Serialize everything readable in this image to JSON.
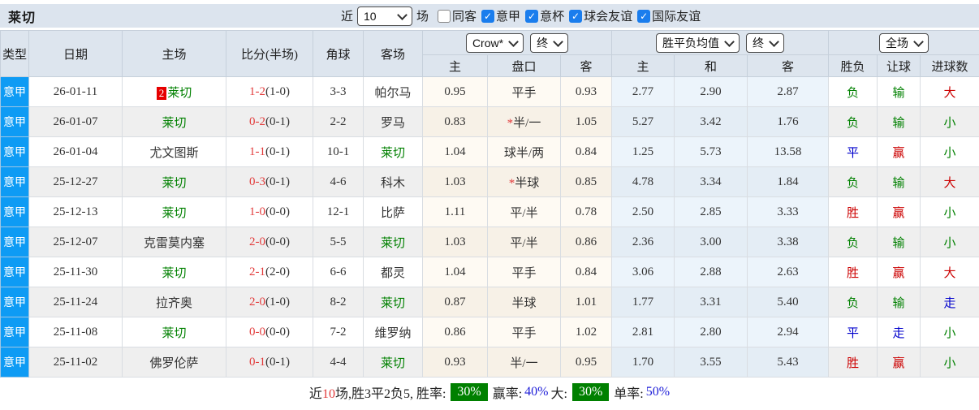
{
  "colors": {
    "league_blue": "#0e9bf4",
    "checkbox_blue": "#1a7ded",
    "win_red": "#cc0000",
    "loss_green": "#008000",
    "draw_blue": "#0000cc",
    "score_red": "#e23b3b",
    "badge_green_bg": "#008000"
  },
  "topbar": {
    "team": "莱切",
    "recent_label": "近",
    "recent_value": "10",
    "matches_label": "场",
    "filters": [
      {
        "label": "同客",
        "checked": false
      },
      {
        "label": "意甲",
        "checked": true
      },
      {
        "label": "意杯",
        "checked": true
      },
      {
        "label": "球会友谊",
        "checked": true
      },
      {
        "label": "国际友谊",
        "checked": true
      }
    ]
  },
  "table": {
    "col_headers": {
      "type": "类型",
      "date": "日期",
      "home": "主场",
      "score": "比分(半场)",
      "corner": "角球",
      "away": "客场",
      "odds_home": "主",
      "odds_line": "盘口",
      "odds_away": "客",
      "avg_home": "主",
      "avg_draw": "和",
      "avg_away": "客",
      "result": "胜负",
      "handicap": "让球",
      "goals": "进球数"
    },
    "selects": {
      "source": "Crow*",
      "source_time": "终",
      "avg": "胜平负均值",
      "avg_time": "终",
      "scope": "全场"
    },
    "rows": [
      {
        "league": "意甲",
        "date": "26-01-11",
        "home": "莱切",
        "home_badge": "2",
        "home_cls": "green",
        "score": "1-2",
        "half": "(1-0)",
        "corner": "3-3",
        "away": "帕尔马",
        "away_cls": "black",
        "oh": "0.95",
        "line": "平手",
        "line_star": false,
        "oa": "0.93",
        "eh": "2.77",
        "ed": "2.90",
        "ea": "2.87",
        "res": "负",
        "res_cls": "green",
        "let": "输",
        "let_cls": "green",
        "goal": "大",
        "goal_cls": "red"
      },
      {
        "league": "意甲",
        "date": "26-01-07",
        "home": "莱切",
        "home_badge": "",
        "home_cls": "green",
        "score": "0-2",
        "half": "(0-1)",
        "corner": "2-2",
        "away": "罗马",
        "away_cls": "black",
        "oh": "0.83",
        "line": "半/一",
        "line_star": true,
        "oa": "1.05",
        "eh": "5.27",
        "ed": "3.42",
        "ea": "1.76",
        "res": "负",
        "res_cls": "green",
        "let": "输",
        "let_cls": "green",
        "goal": "小",
        "goal_cls": "green"
      },
      {
        "league": "意甲",
        "date": "26-01-04",
        "home": "尤文图斯",
        "home_badge": "",
        "home_cls": "black",
        "score": "1-1",
        "half": "(0-1)",
        "corner": "10-1",
        "away": "莱切",
        "away_cls": "green",
        "oh": "1.04",
        "line": "球半/两",
        "line_star": false,
        "oa": "0.84",
        "eh": "1.25",
        "ed": "5.73",
        "ea": "13.58",
        "res": "平",
        "res_cls": "blue",
        "let": "赢",
        "let_cls": "red",
        "goal": "小",
        "goal_cls": "green"
      },
      {
        "league": "意甲",
        "date": "25-12-27",
        "home": "莱切",
        "home_badge": "",
        "home_cls": "green",
        "score": "0-3",
        "half": "(0-1)",
        "corner": "4-6",
        "away": "科木",
        "away_cls": "black",
        "oh": "1.03",
        "line": "半球",
        "line_star": true,
        "oa": "0.85",
        "eh": "4.78",
        "ed": "3.34",
        "ea": "1.84",
        "res": "负",
        "res_cls": "green",
        "let": "输",
        "let_cls": "green",
        "goal": "大",
        "goal_cls": "red"
      },
      {
        "league": "意甲",
        "date": "25-12-13",
        "home": "莱切",
        "home_badge": "",
        "home_cls": "green",
        "score": "1-0",
        "half": "(0-0)",
        "corner": "12-1",
        "away": "比萨",
        "away_cls": "black",
        "oh": "1.11",
        "line": "平/半",
        "line_star": false,
        "oa": "0.78",
        "eh": "2.50",
        "ed": "2.85",
        "ea": "3.33",
        "res": "胜",
        "res_cls": "red",
        "let": "赢",
        "let_cls": "red",
        "goal": "小",
        "goal_cls": "green"
      },
      {
        "league": "意甲",
        "date": "25-12-07",
        "home": "克雷莫内塞",
        "home_badge": "",
        "home_cls": "black",
        "score": "2-0",
        "half": "(0-0)",
        "corner": "5-5",
        "away": "莱切",
        "away_cls": "green",
        "oh": "1.03",
        "line": "平/半",
        "line_star": false,
        "oa": "0.86",
        "eh": "2.36",
        "ed": "3.00",
        "ea": "3.38",
        "res": "负",
        "res_cls": "green",
        "let": "输",
        "let_cls": "green",
        "goal": "小",
        "goal_cls": "green"
      },
      {
        "league": "意甲",
        "date": "25-11-30",
        "home": "莱切",
        "home_badge": "",
        "home_cls": "green",
        "score": "2-1",
        "half": "(2-0)",
        "corner": "6-6",
        "away": "都灵",
        "away_cls": "black",
        "oh": "1.04",
        "line": "平手",
        "line_star": false,
        "oa": "0.84",
        "eh": "3.06",
        "ed": "2.88",
        "ea": "2.63",
        "res": "胜",
        "res_cls": "red",
        "let": "赢",
        "let_cls": "red",
        "goal": "大",
        "goal_cls": "red"
      },
      {
        "league": "意甲",
        "date": "25-11-24",
        "home": "拉齐奥",
        "home_badge": "",
        "home_cls": "black",
        "score": "2-0",
        "half": "(1-0)",
        "corner": "8-2",
        "away": "莱切",
        "away_cls": "green",
        "oh": "0.87",
        "line": "半球",
        "line_star": false,
        "oa": "1.01",
        "eh": "1.77",
        "ed": "3.31",
        "ea": "5.40",
        "res": "负",
        "res_cls": "green",
        "let": "输",
        "let_cls": "green",
        "goal": "走",
        "goal_cls": "blue"
      },
      {
        "league": "意甲",
        "date": "25-11-08",
        "home": "莱切",
        "home_badge": "",
        "home_cls": "green",
        "score": "0-0",
        "half": "(0-0)",
        "corner": "7-2",
        "away": "维罗纳",
        "away_cls": "black",
        "oh": "0.86",
        "line": "平手",
        "line_star": false,
        "oa": "1.02",
        "eh": "2.81",
        "ed": "2.80",
        "ea": "2.94",
        "res": "平",
        "res_cls": "blue",
        "let": "走",
        "let_cls": "blue",
        "goal": "小",
        "goal_cls": "green"
      },
      {
        "league": "意甲",
        "date": "25-11-02",
        "home": "佛罗伦萨",
        "home_badge": "",
        "home_cls": "black",
        "score": "0-1",
        "half": "(0-1)",
        "corner": "4-4",
        "away": "莱切",
        "away_cls": "green",
        "oh": "0.93",
        "line": "半/一",
        "line_star": false,
        "oa": "0.95",
        "eh": "1.70",
        "ed": "3.55",
        "ea": "5.43",
        "res": "胜",
        "res_cls": "red",
        "let": "赢",
        "let_cls": "red",
        "goal": "小",
        "goal_cls": "green"
      }
    ]
  },
  "summary": {
    "seg1": "近",
    "count": "10",
    "seg2": "场,胜3平2负5, 胜率:",
    "win_rate": "30%",
    "seg3": "赢率:",
    "win_pct": "40%",
    "seg4": "大:",
    "big_pct": "30%",
    "seg5": "单率:",
    "single_pct": "50%"
  }
}
